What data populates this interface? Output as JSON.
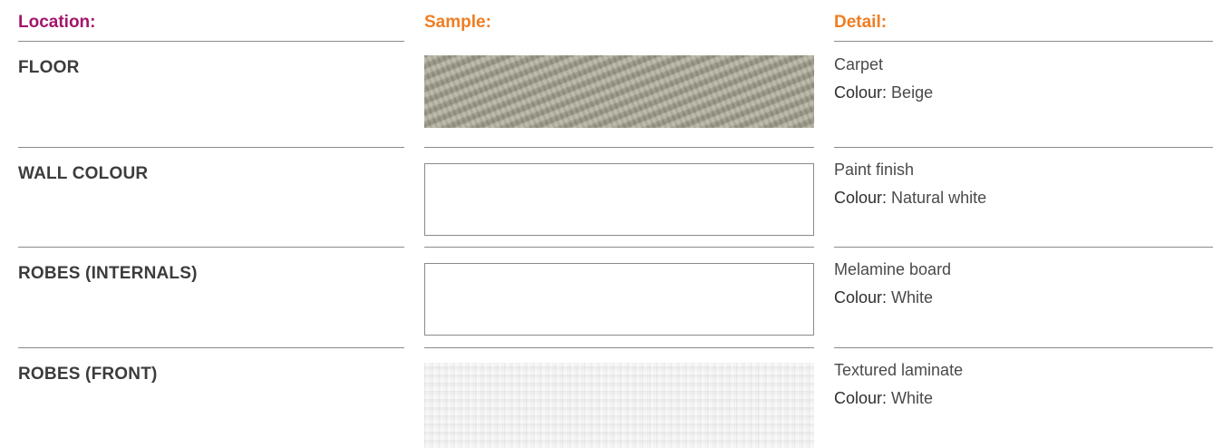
{
  "headers": {
    "location": "Location:",
    "sample": "Sample:",
    "detail": "Detail:"
  },
  "colors": {
    "location_header": "#a3156b",
    "sample_header": "#ef7d22",
    "detail_header": "#ef7d22"
  },
  "rows": [
    {
      "location": "FLOOR",
      "sample": "carpet-texture",
      "material": "Carpet",
      "colour_label": "Colour:",
      "colour_value": "Beige"
    },
    {
      "location": "WALL COLOUR",
      "sample": "blank-swatch",
      "material": "Paint finish",
      "colour_label": "Colour:",
      "colour_value": "Natural white"
    },
    {
      "location": "ROBES (INTERNALS)",
      "sample": "blank-swatch",
      "material": "Melamine board",
      "colour_label": "Colour:",
      "colour_value": "White"
    },
    {
      "location": "ROBES (FRONT)",
      "sample": "laminate-texture",
      "material": "Textured laminate",
      "colour_label": "Colour:",
      "colour_value": "White"
    }
  ]
}
